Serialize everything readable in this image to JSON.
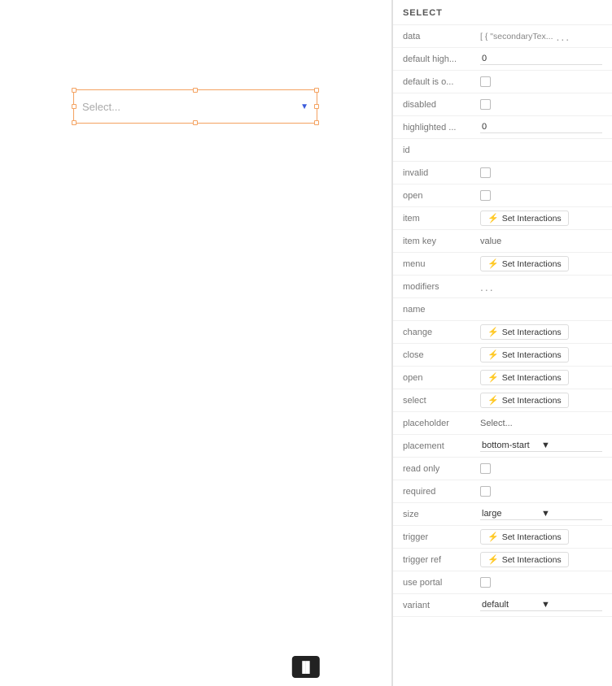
{
  "panel": {
    "title": "SELECT"
  },
  "canvas": {
    "select_placeholder": "Select..."
  },
  "props": [
    {
      "label": "data",
      "type": "text",
      "value": "[ { \"secondaryTex...",
      "extra": "..."
    },
    {
      "label": "default high...",
      "type": "input",
      "value": "0"
    },
    {
      "label": "default is o...",
      "type": "checkbox",
      "checked": false
    },
    {
      "label": "disabled",
      "type": "checkbox",
      "checked": false
    },
    {
      "label": "highlighted ...",
      "type": "input",
      "value": "0"
    },
    {
      "label": "id",
      "type": "empty"
    },
    {
      "label": "invalid",
      "type": "checkbox",
      "checked": false
    },
    {
      "label": "open",
      "type": "checkbox",
      "checked": false
    },
    {
      "label": "item",
      "type": "interactions",
      "btnLabel": "Set Interactions"
    },
    {
      "label": "item key",
      "type": "text-value",
      "value": "value"
    },
    {
      "label": "menu",
      "type": "interactions",
      "btnLabel": "Set Interactions"
    },
    {
      "label": "modifiers",
      "type": "dots"
    },
    {
      "label": "name",
      "type": "empty"
    },
    {
      "label": "change",
      "type": "interactions",
      "btnLabel": "Set Interactions"
    },
    {
      "label": "close",
      "type": "interactions",
      "btnLabel": "Set Interactions"
    },
    {
      "label": "open",
      "type": "interactions",
      "btnLabel": "Set Interactions"
    },
    {
      "label": "select",
      "type": "interactions",
      "btnLabel": "Set Interactions"
    },
    {
      "label": "placeholder",
      "type": "text-value",
      "value": "Select..."
    },
    {
      "label": "placement",
      "type": "dropdown",
      "value": "bottom-start"
    },
    {
      "label": "read only",
      "type": "checkbox",
      "checked": false
    },
    {
      "label": "required",
      "type": "checkbox",
      "checked": false
    },
    {
      "label": "size",
      "type": "dropdown",
      "value": "large"
    },
    {
      "label": "trigger",
      "type": "interactions",
      "btnLabel": "Set Interactions"
    },
    {
      "label": "trigger ref",
      "type": "interactions",
      "btnLabel": "Set Interactions"
    },
    {
      "label": "use portal",
      "type": "checkbox",
      "checked": false
    },
    {
      "label": "variant",
      "type": "dropdown",
      "value": "default"
    }
  ],
  "bottom_icon": "⊟",
  "bolt_symbol": "⚡"
}
